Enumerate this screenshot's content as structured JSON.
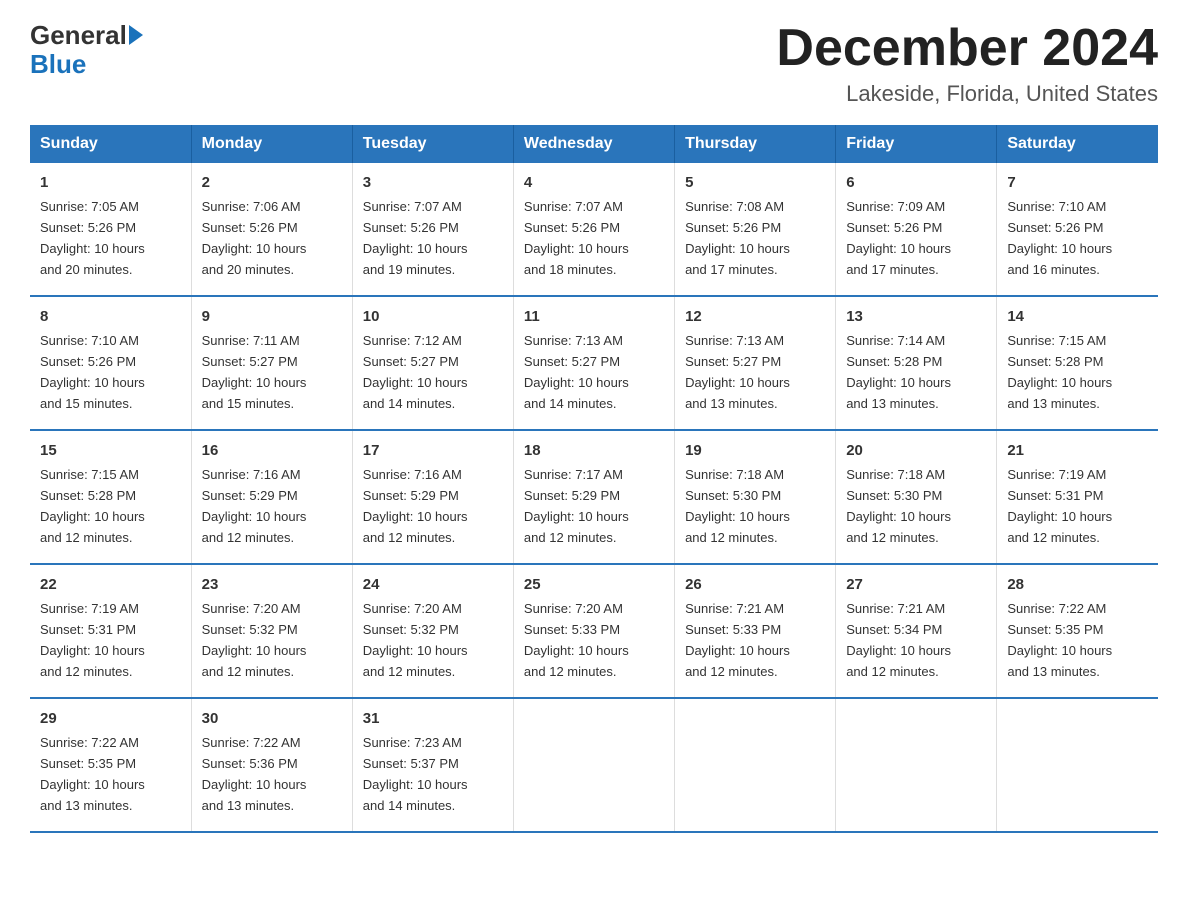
{
  "logo": {
    "general": "General",
    "arrow": "▶",
    "blue": "Blue"
  },
  "title": "December 2024",
  "location": "Lakeside, Florida, United States",
  "days_of_week": [
    "Sunday",
    "Monday",
    "Tuesday",
    "Wednesday",
    "Thursday",
    "Friday",
    "Saturday"
  ],
  "weeks": [
    [
      {
        "day": "1",
        "sunrise": "7:05 AM",
        "sunset": "5:26 PM",
        "daylight": "10 hours and 20 minutes."
      },
      {
        "day": "2",
        "sunrise": "7:06 AM",
        "sunset": "5:26 PM",
        "daylight": "10 hours and 20 minutes."
      },
      {
        "day": "3",
        "sunrise": "7:07 AM",
        "sunset": "5:26 PM",
        "daylight": "10 hours and 19 minutes."
      },
      {
        "day": "4",
        "sunrise": "7:07 AM",
        "sunset": "5:26 PM",
        "daylight": "10 hours and 18 minutes."
      },
      {
        "day": "5",
        "sunrise": "7:08 AM",
        "sunset": "5:26 PM",
        "daylight": "10 hours and 17 minutes."
      },
      {
        "day": "6",
        "sunrise": "7:09 AM",
        "sunset": "5:26 PM",
        "daylight": "10 hours and 17 minutes."
      },
      {
        "day": "7",
        "sunrise": "7:10 AM",
        "sunset": "5:26 PM",
        "daylight": "10 hours and 16 minutes."
      }
    ],
    [
      {
        "day": "8",
        "sunrise": "7:10 AM",
        "sunset": "5:26 PM",
        "daylight": "10 hours and 15 minutes."
      },
      {
        "day": "9",
        "sunrise": "7:11 AM",
        "sunset": "5:27 PM",
        "daylight": "10 hours and 15 minutes."
      },
      {
        "day": "10",
        "sunrise": "7:12 AM",
        "sunset": "5:27 PM",
        "daylight": "10 hours and 14 minutes."
      },
      {
        "day": "11",
        "sunrise": "7:13 AM",
        "sunset": "5:27 PM",
        "daylight": "10 hours and 14 minutes."
      },
      {
        "day": "12",
        "sunrise": "7:13 AM",
        "sunset": "5:27 PM",
        "daylight": "10 hours and 13 minutes."
      },
      {
        "day": "13",
        "sunrise": "7:14 AM",
        "sunset": "5:28 PM",
        "daylight": "10 hours and 13 minutes."
      },
      {
        "day": "14",
        "sunrise": "7:15 AM",
        "sunset": "5:28 PM",
        "daylight": "10 hours and 13 minutes."
      }
    ],
    [
      {
        "day": "15",
        "sunrise": "7:15 AM",
        "sunset": "5:28 PM",
        "daylight": "10 hours and 12 minutes."
      },
      {
        "day": "16",
        "sunrise": "7:16 AM",
        "sunset": "5:29 PM",
        "daylight": "10 hours and 12 minutes."
      },
      {
        "day": "17",
        "sunrise": "7:16 AM",
        "sunset": "5:29 PM",
        "daylight": "10 hours and 12 minutes."
      },
      {
        "day": "18",
        "sunrise": "7:17 AM",
        "sunset": "5:29 PM",
        "daylight": "10 hours and 12 minutes."
      },
      {
        "day": "19",
        "sunrise": "7:18 AM",
        "sunset": "5:30 PM",
        "daylight": "10 hours and 12 minutes."
      },
      {
        "day": "20",
        "sunrise": "7:18 AM",
        "sunset": "5:30 PM",
        "daylight": "10 hours and 12 minutes."
      },
      {
        "day": "21",
        "sunrise": "7:19 AM",
        "sunset": "5:31 PM",
        "daylight": "10 hours and 12 minutes."
      }
    ],
    [
      {
        "day": "22",
        "sunrise": "7:19 AM",
        "sunset": "5:31 PM",
        "daylight": "10 hours and 12 minutes."
      },
      {
        "day": "23",
        "sunrise": "7:20 AM",
        "sunset": "5:32 PM",
        "daylight": "10 hours and 12 minutes."
      },
      {
        "day": "24",
        "sunrise": "7:20 AM",
        "sunset": "5:32 PM",
        "daylight": "10 hours and 12 minutes."
      },
      {
        "day": "25",
        "sunrise": "7:20 AM",
        "sunset": "5:33 PM",
        "daylight": "10 hours and 12 minutes."
      },
      {
        "day": "26",
        "sunrise": "7:21 AM",
        "sunset": "5:33 PM",
        "daylight": "10 hours and 12 minutes."
      },
      {
        "day": "27",
        "sunrise": "7:21 AM",
        "sunset": "5:34 PM",
        "daylight": "10 hours and 12 minutes."
      },
      {
        "day": "28",
        "sunrise": "7:22 AM",
        "sunset": "5:35 PM",
        "daylight": "10 hours and 13 minutes."
      }
    ],
    [
      {
        "day": "29",
        "sunrise": "7:22 AM",
        "sunset": "5:35 PM",
        "daylight": "10 hours and 13 minutes."
      },
      {
        "day": "30",
        "sunrise": "7:22 AM",
        "sunset": "5:36 PM",
        "daylight": "10 hours and 13 minutes."
      },
      {
        "day": "31",
        "sunrise": "7:23 AM",
        "sunset": "5:37 PM",
        "daylight": "10 hours and 14 minutes."
      },
      null,
      null,
      null,
      null
    ]
  ],
  "labels": {
    "sunrise": "Sunrise:",
    "sunset": "Sunset:",
    "daylight": "Daylight:"
  }
}
